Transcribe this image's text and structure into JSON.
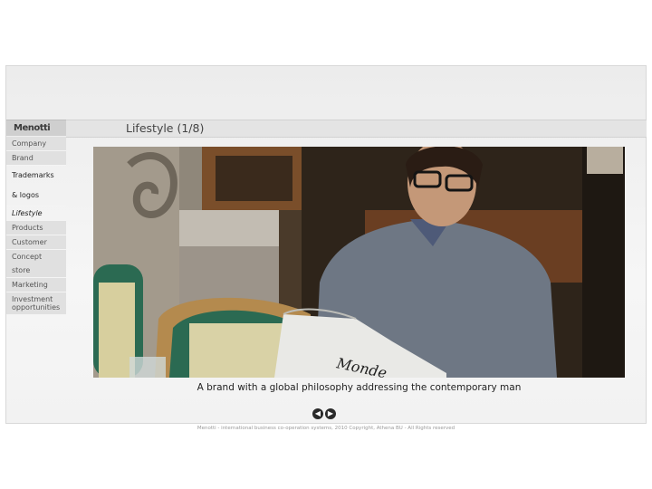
{
  "header": {
    "logo_text": "Menotti",
    "page_title": "Lifestyle (1/8)"
  },
  "nav": {
    "items": [
      {
        "label": "Company"
      },
      {
        "label": "Brand"
      },
      {
        "label": "Trademarks & logos"
      },
      {
        "label": "Lifestyle"
      },
      {
        "label": "Products"
      },
      {
        "label": "Customer"
      },
      {
        "label": "Concept store"
      },
      {
        "label": "Marketing"
      },
      {
        "label": "Investment opportunities"
      }
    ],
    "active": "Lifestyle"
  },
  "slide": {
    "caption": "A brand with a global philosophy addressing the contemporary man",
    "prev_icon": "arrow-left-icon",
    "next_icon": "arrow-right-icon",
    "newspaper_text": "Monde"
  },
  "footer": {
    "text": "Menotti - international business co-operation systems, 2010 Copyright, Athena BU - All Rights reserved"
  }
}
